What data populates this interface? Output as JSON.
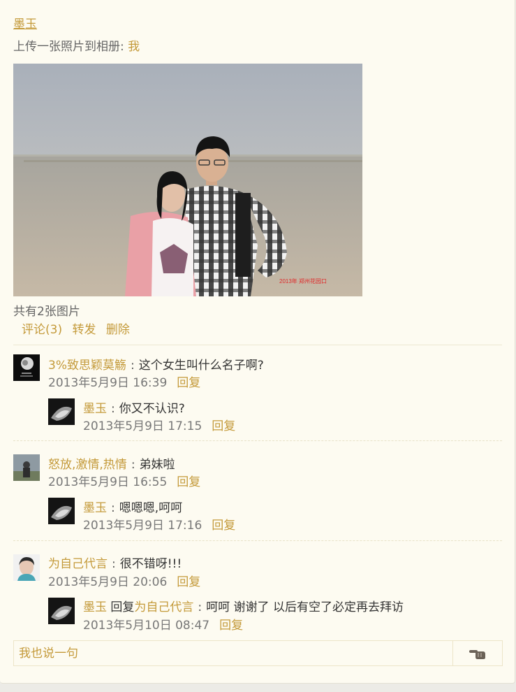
{
  "post": {
    "author": "墨玉",
    "action_prefix": "上传一张照片到相册:",
    "album_link": "我",
    "photo_caption": "2013年  郑州花园口",
    "image_count": "共有2张图片",
    "actions": {
      "comment": "评论(3)",
      "forward": "转发",
      "delete": "删除"
    }
  },
  "comments": [
    {
      "user": "3%致思颖莫觞",
      "text": "这个女生叫什么名子啊?",
      "time": "2013年5月9日 16:39",
      "reply_label": "回复",
      "reply": {
        "user": "墨玉",
        "text": "你又不认识?",
        "time": "2013年5月9日 17:15",
        "reply_label": "回复"
      }
    },
    {
      "user": "怒放,激情,热情",
      "text": "弟妹啦",
      "time": "2013年5月9日 16:55",
      "reply_label": "回复",
      "reply": {
        "user": "墨玉",
        "text": "嗯嗯嗯,呵呵",
        "time": "2013年5月9日 17:16",
        "reply_label": "回复"
      }
    },
    {
      "user": "为自己代言",
      "text": "很不错呀!!!",
      "time": "2013年5月9日 20:06",
      "reply_label": "回复",
      "reply": {
        "user": "墨玉",
        "reply_word": "回复",
        "reply_to": "为自己代言",
        "text": "呵呵 谢谢了 以后有空了必定再去拜访",
        "time": "2013年5月10日 08:47",
        "reply_label": "回复"
      }
    }
  ],
  "input": {
    "placeholder": "我也说一句"
  },
  "colors": {
    "link": "#c49a3a",
    "background": "#fdfbf1"
  },
  "icons": {
    "send": "pointing-hand-icon"
  }
}
